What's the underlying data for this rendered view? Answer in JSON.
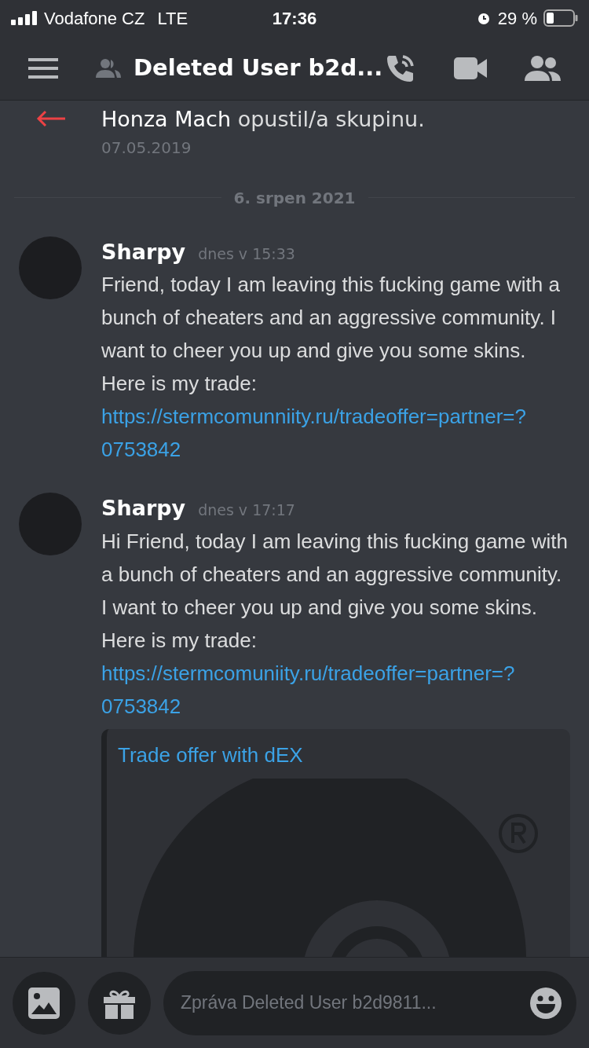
{
  "status_bar": {
    "carrier": "Vodafone CZ",
    "network": "LTE",
    "time": "17:36",
    "battery": "29 %"
  },
  "header": {
    "title": "Deleted User b2d..."
  },
  "system_message": {
    "user": "Honza Mach",
    "action": "opustil/a skupinu.",
    "date": "07.05.2019"
  },
  "date_divider": "6. srpen 2021",
  "messages": [
    {
      "author": "Sharpy",
      "time": "dnes v 15:33",
      "text": "Friend, today I am leaving this fucking game with a bunch of cheaters and an aggressive community. I want to cheer you up and give you some skins. Here is my trade:",
      "link": "https://stermcomunniity.ru/tradeoffer=partner=?0753842"
    },
    {
      "author": "Sharpy",
      "time": "dnes v 17:17",
      "text": "Hi Friend, today I am leaving this fucking game with a bunch of cheaters and an aggressive community. I want to cheer you up and give you some skins. Here is my trade:",
      "link": "https://stermcomuniity.ru/tradeoffer=partner=?0753842",
      "embed": {
        "title": "Trade offer with dEX"
      }
    }
  ],
  "composer": {
    "placeholder": "Zpráva Deleted User b2d9811..."
  }
}
